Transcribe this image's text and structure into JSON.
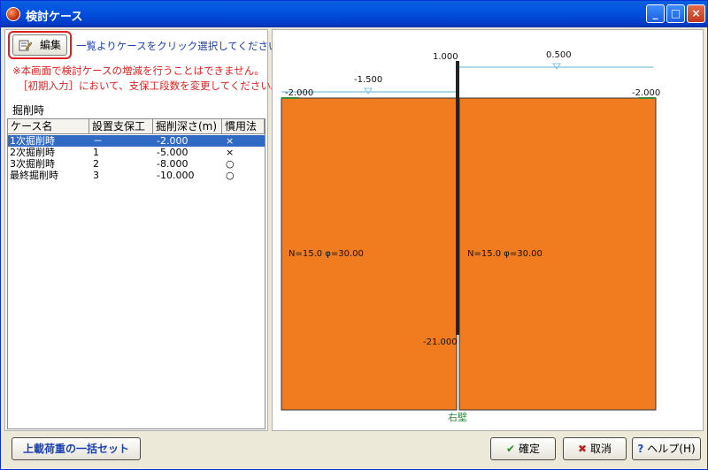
{
  "window": {
    "title": "検討ケース"
  },
  "left": {
    "edit_label": "編集",
    "hint": "一覧よりケースをクリック選択してください",
    "warning1": "※本画面で検討ケースの増減を行うことはできません。",
    "warning2": "［初期入力］において、支保工段数を変更してください。",
    "section": "掘削時",
    "columns": [
      "ケース名",
      "設置支保工",
      "掘削深さ(m)",
      "慣用法"
    ],
    "rows": [
      {
        "name": "1次掘削時",
        "support": "－",
        "depth": "-2.000",
        "method": "×"
      },
      {
        "name": "2次掘削時",
        "support": "1",
        "depth": "-5.000",
        "method": "×"
      },
      {
        "name": "3次掘削時",
        "support": "2",
        "depth": "-8.000",
        "method": "○"
      },
      {
        "name": "最終掘削時",
        "support": "3",
        "depth": "-10.000",
        "method": "○"
      }
    ]
  },
  "diagram": {
    "top_left_level": "-2.000",
    "top_right_level": "-2.000",
    "wall_top_level": "1.000",
    "water_left": "-1.500",
    "water_right": "0.500",
    "wall_bottom_level": "-21.000",
    "soil_left": "N=15.0  φ=30.00",
    "soil_right": "N=15.0  φ=30.00",
    "wall_label": "右壁",
    "soil_color": "#f07c1f",
    "water_color": "#7ec3d8"
  },
  "footer": {
    "bulk_label": "上載荷重の一括セット",
    "ok_label": "確定",
    "cancel_label": "取消",
    "help_label": "ヘルプ(H)"
  }
}
